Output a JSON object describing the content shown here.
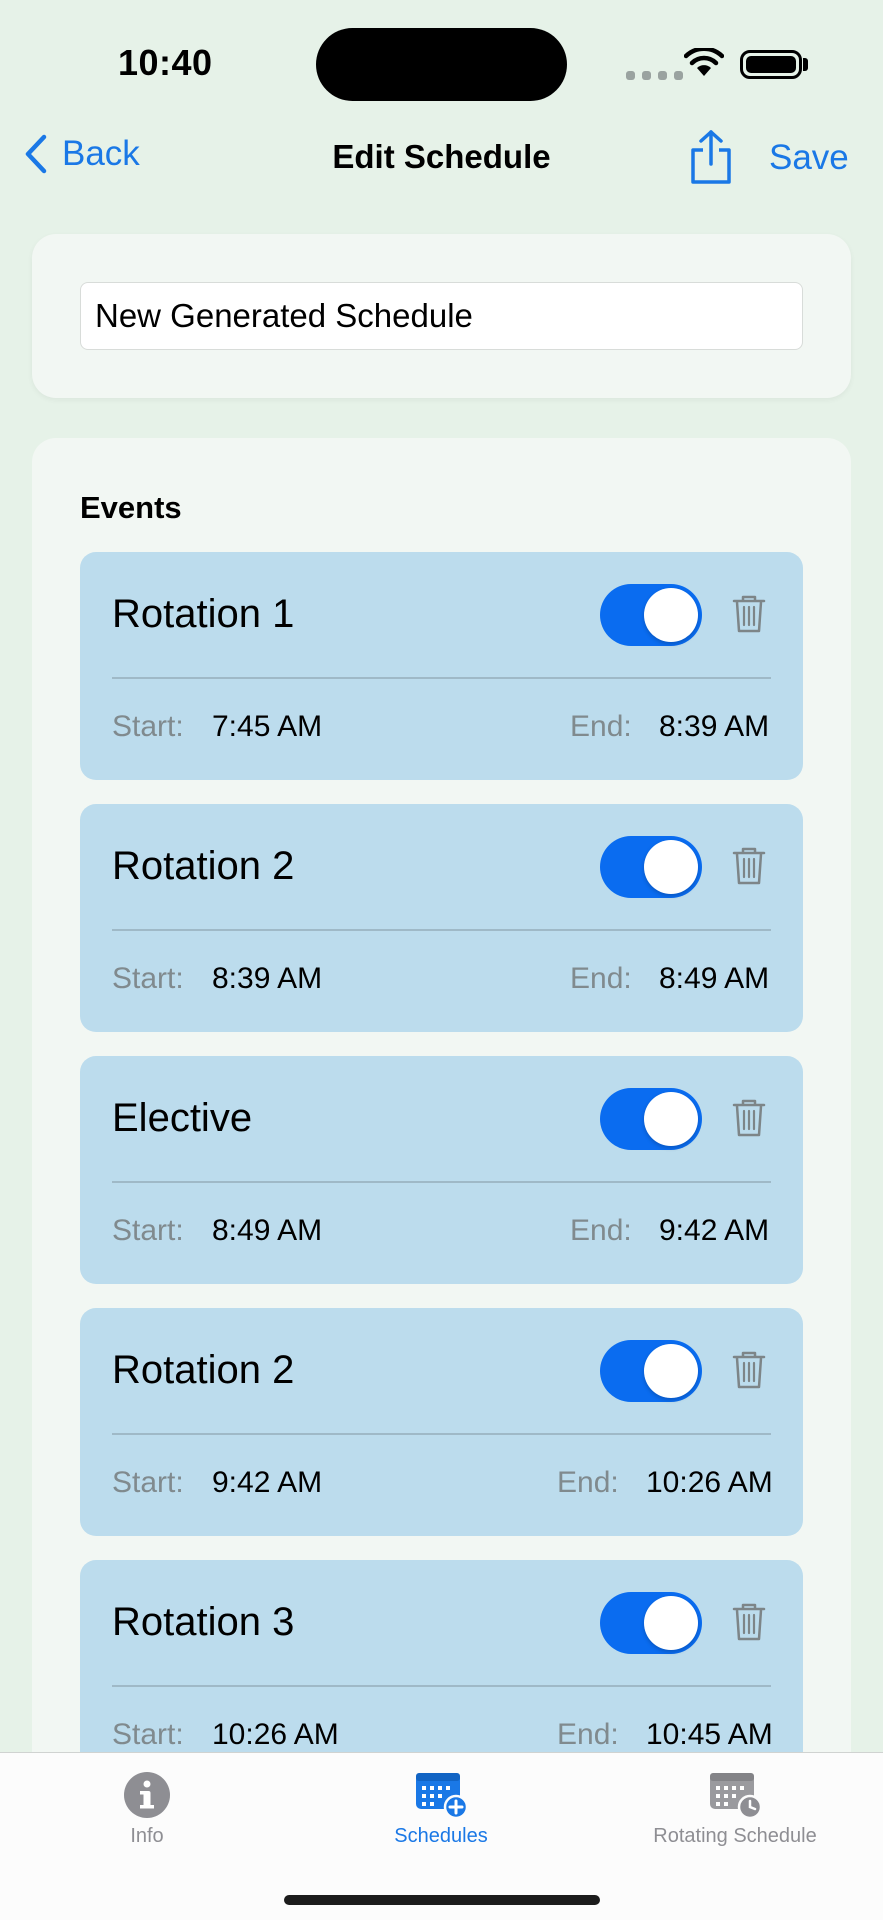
{
  "status_bar": {
    "time": "10:40"
  },
  "nav": {
    "back_label": "Back",
    "title": "Edit Schedule",
    "save_label": "Save"
  },
  "schedule_name": {
    "value": "New Generated Schedule"
  },
  "events": {
    "title": "Events",
    "start_label": "Start:",
    "end_label": "End:",
    "items": [
      {
        "name": "Rotation 1",
        "start": "7:45 AM",
        "end": "8:39 AM",
        "enabled": true
      },
      {
        "name": "Rotation 2",
        "start": "8:39 AM",
        "end": "8:49 AM",
        "enabled": true
      },
      {
        "name": "Elective",
        "start": "8:49 AM",
        "end": "9:42 AM",
        "enabled": true
      },
      {
        "name": "Rotation 2",
        "start": "9:42 AM",
        "end": "10:26 AM",
        "enabled": true
      },
      {
        "name": "Rotation 3",
        "start": "10:26 AM",
        "end": "10:45 AM",
        "enabled": true
      }
    ]
  },
  "tab_bar": {
    "tabs": [
      {
        "label": "Info",
        "icon": "info-icon",
        "active": false
      },
      {
        "label": "Schedules",
        "icon": "calendar-add-icon",
        "active": true
      },
      {
        "label": "Rotating Schedule",
        "icon": "calendar-clock-icon",
        "active": false
      }
    ]
  },
  "colors": {
    "accent": "#1a78e6",
    "toggle_on": "#0a6cf0",
    "background": "#e6f2e8",
    "card": "#f2f7f3",
    "event_row": "#bcdced",
    "tab_inactive": "#8e8e93"
  }
}
